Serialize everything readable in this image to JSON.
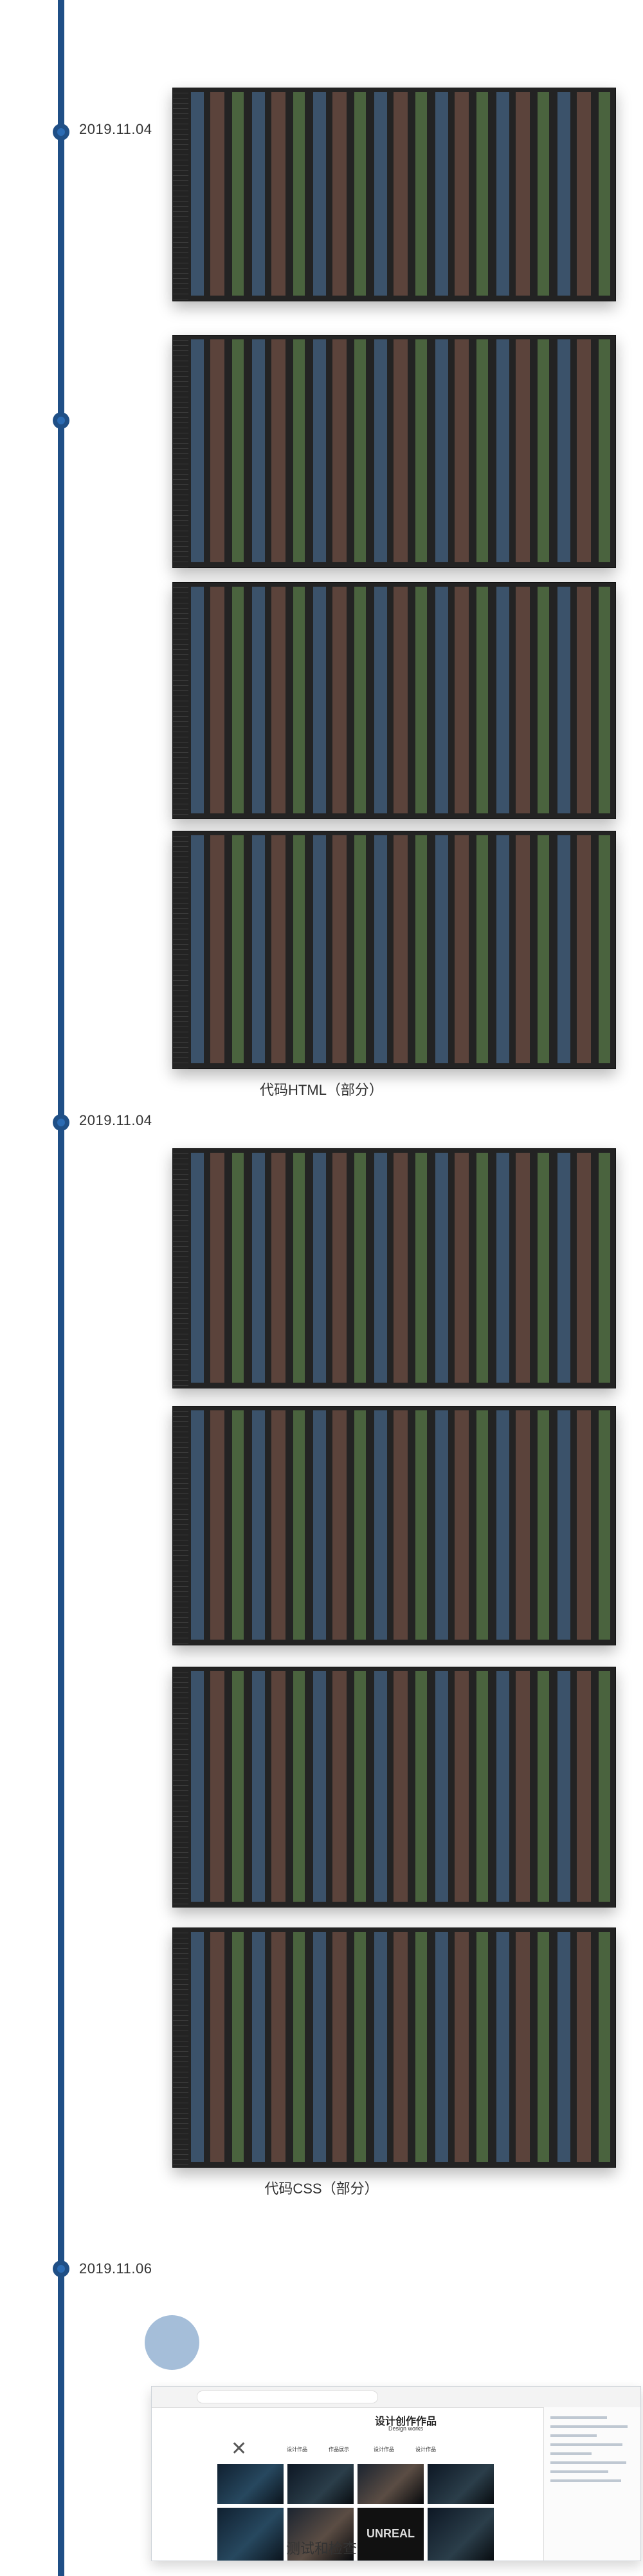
{
  "timeline": {
    "entries": [
      {
        "date": "2019.11.04",
        "caption": "代码HTML（部分）"
      },
      {
        "date": "2019.11.04",
        "caption": "代码CSS（部分）"
      },
      {
        "date": "2019.11.06",
        "caption": "测试和检查"
      }
    ]
  },
  "browser": {
    "title": "设计创作作品",
    "subtitle": "Design works",
    "nav_items": [
      "设计作品",
      "作品展示",
      "设计作品",
      "设计作品"
    ],
    "logo_text": "UNREAL"
  },
  "icons": {
    "close": "close-icon"
  }
}
